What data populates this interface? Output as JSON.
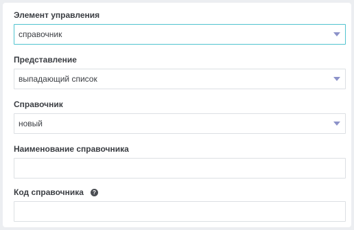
{
  "fields": [
    {
      "label": "Элемент управления",
      "value": "справочник",
      "kind": "select",
      "focused": true,
      "icon": "chevron-down-icon"
    },
    {
      "label": "Представление",
      "value": "выпадающий список",
      "kind": "select",
      "icon": "chevron-down-icon"
    },
    {
      "label": "Справочник",
      "value": "новый",
      "kind": "select",
      "icon": "chevron-down-icon"
    },
    {
      "label": "Наименование справочника",
      "value": "",
      "kind": "text"
    },
    {
      "label": "Код справочника",
      "value": "",
      "kind": "text",
      "help_icon": "question-circle-icon",
      "help_glyph": "?"
    }
  ],
  "colors": {
    "focus_border": "#4fc3cf",
    "caret": "#8c92c9",
    "border": "#dcdfe3",
    "label": "#3a3d42"
  }
}
